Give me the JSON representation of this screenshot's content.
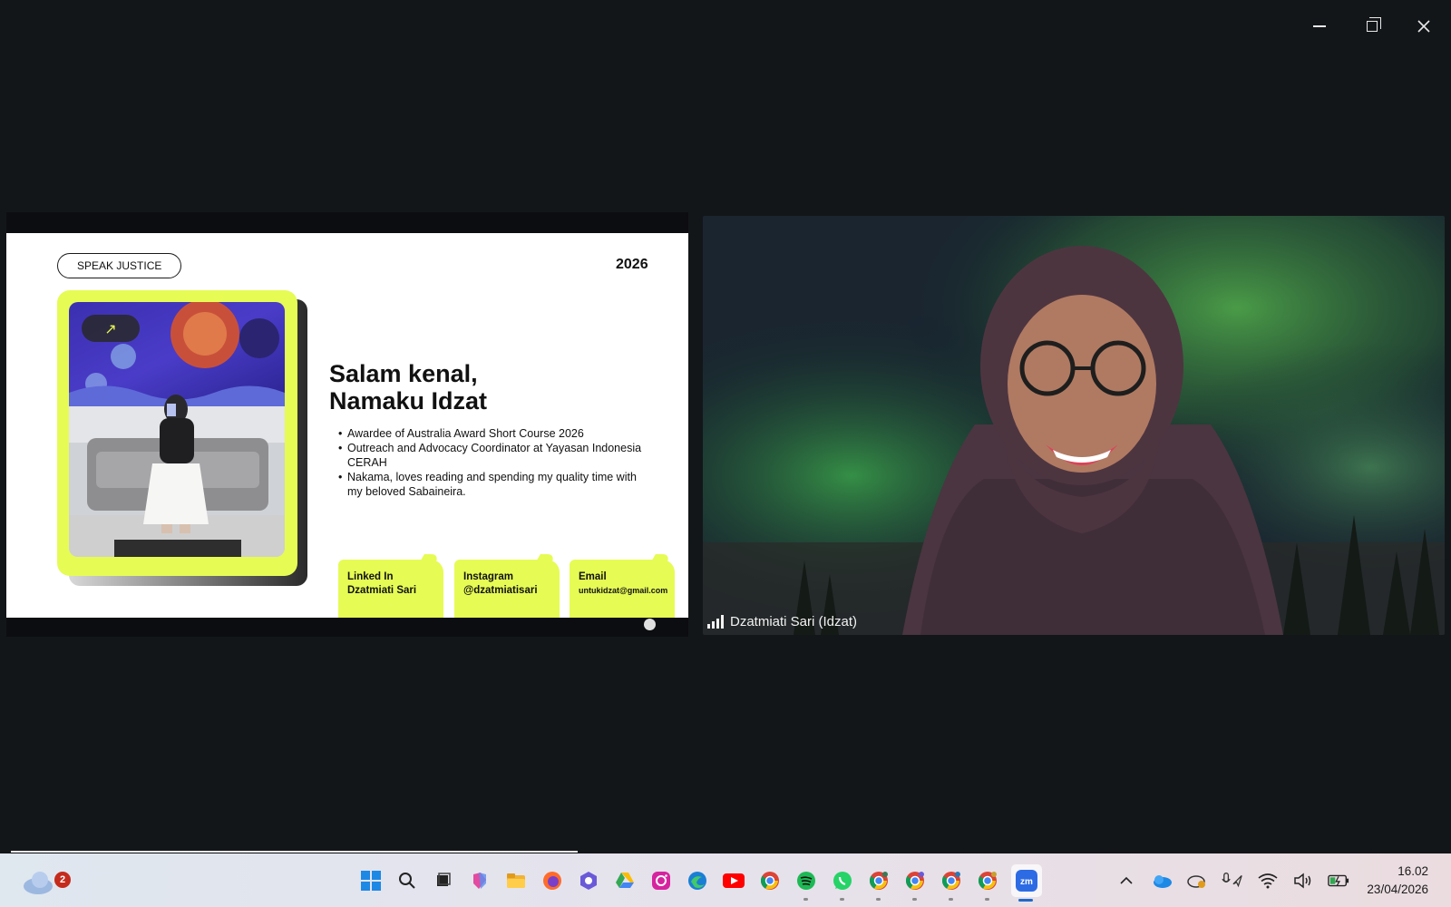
{
  "window": {
    "controls": [
      "minimize",
      "restore",
      "close"
    ]
  },
  "slide": {
    "tag": "SPEAK JUSTICE",
    "year": "2026",
    "headline_line1": "Salam kenal,",
    "headline_line2": "Namaku Idzat",
    "bullets": [
      "Awardee of Australia Award Short Course 2026",
      "Outreach and Advocacy Coordinator at Yayasan Indonesia CERAH",
      "Nakama, loves reading and spending my quality time with my beloved Sabaineira."
    ],
    "cards": {
      "linkedin_label": "Linked In",
      "linkedin_value": "Dzatmiati Sari",
      "instagram_label": "Instagram",
      "instagram_value": "@dzatmiatisari",
      "email_label": "Email",
      "email_value": "untukidzat@gmail.com"
    },
    "accent_color": "#e6fb54"
  },
  "video": {
    "participant_name": "Dzatmiati Sari (Idzat)"
  },
  "taskbar": {
    "weather_badge": "2",
    "apps": [
      "start-icon",
      "search-icon",
      "task-view-icon",
      "copilot-icon",
      "file-explorer-icon",
      "firefox-icon",
      "app-icon",
      "google-drive-icon",
      "instagram-icon",
      "edge-icon",
      "youtube-icon",
      "chrome-icon",
      "spotify-icon",
      "whatsapp-icon",
      "chrome-profile-icon",
      "chrome-profile-icon",
      "chrome-profile-icon",
      "chrome-profile-icon",
      "zoom-icon"
    ],
    "zoom_label": "zm",
    "time": "16.02",
    "date": "23/04/2026"
  }
}
